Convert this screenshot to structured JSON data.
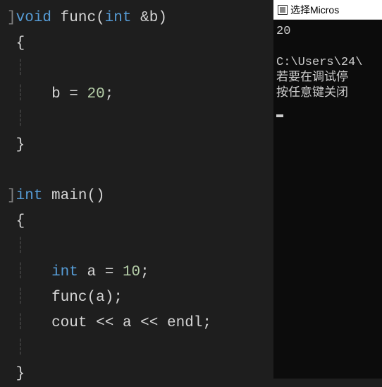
{
  "editor": {
    "lines": {
      "l1_kw": "void",
      "l1_fn": "func",
      "l1_type": "int",
      "l1_amp": "&b",
      "l2_brace": "{",
      "l4_var": "b",
      "l4_eq": "=",
      "l4_val": "20",
      "l5_brace": "}",
      "l7_type": "int",
      "l7_fn": "main",
      "l8_brace": "{",
      "l10_type": "int",
      "l10_var": "a",
      "l10_eq": "=",
      "l10_val": "10",
      "l11_fn": "func",
      "l11_arg": "a",
      "l12_cout": "cout",
      "l12_op": "<<",
      "l12_var": "a",
      "l12_endl": "endl",
      "l14_brace": "}"
    }
  },
  "console": {
    "title": "选择Micros",
    "output": "20",
    "path": "C:\\Users\\24\\",
    "msg1": "若要在调试停",
    "msg2": "按任意键关闭"
  }
}
